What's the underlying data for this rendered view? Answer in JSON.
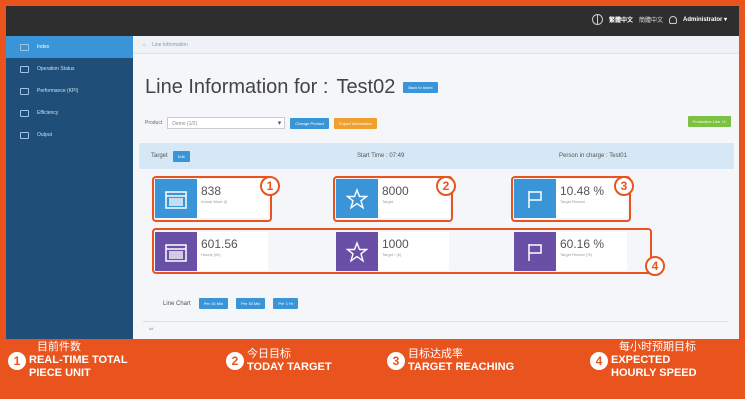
{
  "topbar": {
    "lang_cn": "繁體中文",
    "lang_cn2": "簡體中文",
    "user": "Administrator ▾"
  },
  "sidebar": {
    "items": [
      {
        "label": "Index"
      },
      {
        "label": "Operation Status"
      },
      {
        "label": "Performance (KPI)"
      },
      {
        "label": "Efficiency"
      },
      {
        "label": "Output"
      }
    ]
  },
  "breadcrumb": {
    "home": "⌂",
    "page": "Line Information"
  },
  "title": {
    "prefix": "Line Information for :",
    "line": "Test02",
    "back_btn": "Back to Index"
  },
  "product": {
    "label": "Product",
    "value": "Demo (1/2)",
    "change_btn": "Change Product",
    "export_btn": "Export Information",
    "right_btn": "Production Line +1"
  },
  "target_bar": {
    "label": "Target",
    "edit_btn": "Edit",
    "start_time": "Start Time : 07:49",
    "person": "Person in charge : Test01"
  },
  "cards": [
    {
      "value": "838",
      "label": "Actual Work (i)"
    },
    {
      "value": "8000",
      "label": "Target"
    },
    {
      "value": "10.48 %",
      "label": "Target Reachi"
    },
    {
      "value": "601.56",
      "label": "Hourly (i/h)"
    },
    {
      "value": "1000",
      "label": "Target / (h)"
    },
    {
      "value": "60.16 %",
      "label": "Target Reachi (%)"
    }
  ],
  "markers": [
    "1",
    "2",
    "3",
    "4"
  ],
  "chart": {
    "label": "Line Chart",
    "btn1": "Per 15 Min",
    "btn2": "Per 30 Min",
    "btn3": "Per 1 Hr",
    "axis_hint": "##"
  },
  "legend": [
    {
      "num": "1",
      "cn": "目前件数",
      "en1": "REAL-TIME TOTAL",
      "en2": "PIECE UNIT"
    },
    {
      "num": "2",
      "cn": "今日目标",
      "en1": "TODAY TARGET",
      "en2": ""
    },
    {
      "num": "3",
      "cn": "目标达成率",
      "en1": "TARGET REACHING",
      "en2": ""
    },
    {
      "num": "4",
      "cn": "每小时预期目标",
      "en1": "EXPECTED",
      "en2": "HOURLY SPEED"
    }
  ],
  "colors": {
    "frame": "#e8531e",
    "sidebar": "#1f4e78",
    "accent": "#3a95d8",
    "purple": "#6a4fa6"
  }
}
